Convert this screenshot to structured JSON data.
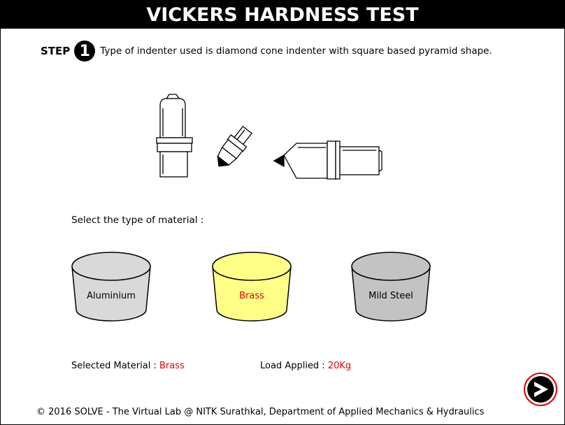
{
  "header": {
    "title": "VICKERS HARDNESS TEST"
  },
  "step": {
    "word": "STEP",
    "number": "1",
    "text": "Type of indenter used is diamond cone indenter with square based pyramid shape."
  },
  "select_prompt": "Select the type of material :",
  "materials": [
    {
      "label": "Aluminium",
      "color": "#d9d9d9",
      "selected": false
    },
    {
      "label": "Brass",
      "color": "#ffff88",
      "selected": true
    },
    {
      "label": "Mild Steel",
      "color": "#c3c3c3",
      "selected": false
    }
  ],
  "info": {
    "selected_label": "Selected Material :",
    "selected_value": "Brass",
    "load_label": "Load Applied :",
    "load_value": "20Kg"
  },
  "accent_color": "#e00000",
  "next_icon": "next-arrow-icon",
  "footer": "© 2016 SOLVE - The Virtual Lab @ NITK Surathkal, Department of Applied Mechanics & Hydraulics"
}
